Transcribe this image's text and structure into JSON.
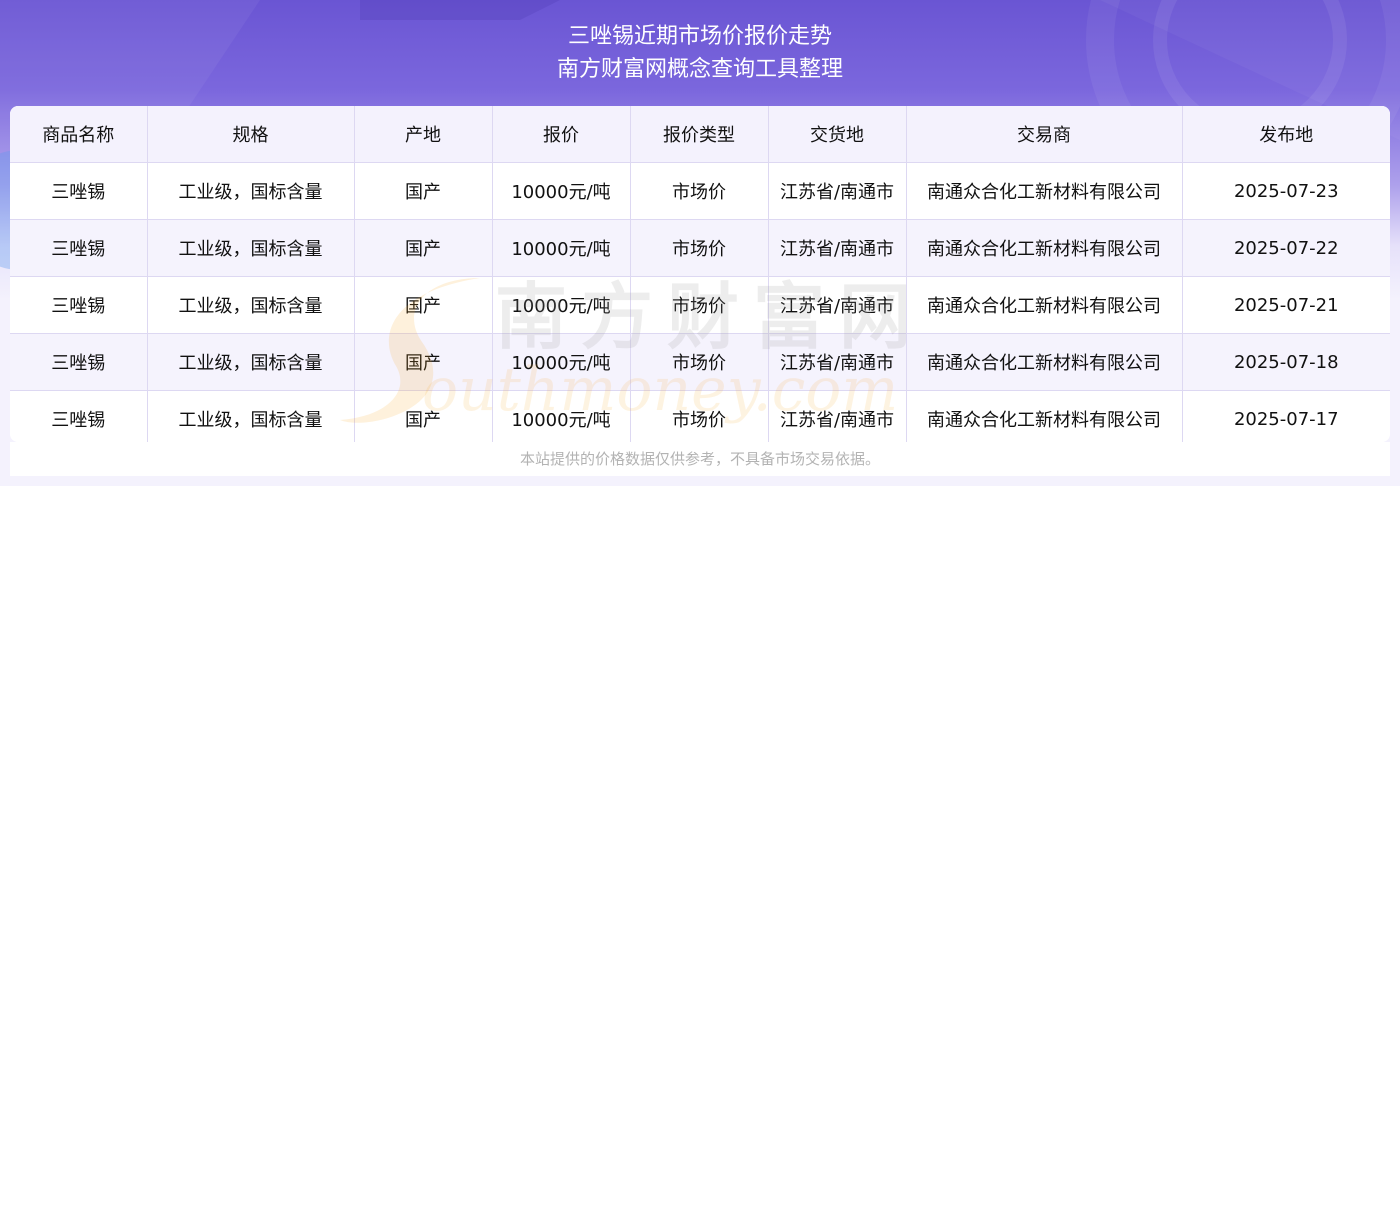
{
  "header": {
    "title_line1": "三唑锡近期市场价报价走势",
    "title_line2": "南方财富网概念查询工具整理"
  },
  "table": {
    "columns": [
      "商品名称",
      "规格",
      "产地",
      "报价",
      "报价类型",
      "交货地",
      "交易商",
      "发布地"
    ],
    "rows": [
      [
        "三唑锡",
        "工业级，国标含量",
        "国产",
        "10000元/吨",
        "市场价",
        "江苏省/南通市",
        "南通众合化工新材料有限公司",
        "2025-07-23"
      ],
      [
        "三唑锡",
        "工业级，国标含量",
        "国产",
        "10000元/吨",
        "市场价",
        "江苏省/南通市",
        "南通众合化工新材料有限公司",
        "2025-07-22"
      ],
      [
        "三唑锡",
        "工业级，国标含量",
        "国产",
        "10000元/吨",
        "市场价",
        "江苏省/南通市",
        "南通众合化工新材料有限公司",
        "2025-07-21"
      ],
      [
        "三唑锡",
        "工业级，国标含量",
        "国产",
        "10000元/吨",
        "市场价",
        "江苏省/南通市",
        "南通众合化工新材料有限公司",
        "2025-07-18"
      ],
      [
        "三唑锡",
        "工业级，国标含量",
        "国产",
        "10000元/吨",
        "市场价",
        "江苏省/南通市",
        "南通众合化工新材料有限公司",
        "2025-07-17"
      ]
    ]
  },
  "watermark": {
    "chinese": "南方财富网",
    "latin": "outhmoney.com"
  },
  "footer": {
    "disclaimer": "本站提供的价格数据仅供参考，不具备市场交易依据。"
  },
  "colors": {
    "header_purple": "#6a55d3",
    "table_header_bg": "#f4f2fd",
    "watermark_orange": "#f6a623"
  }
}
